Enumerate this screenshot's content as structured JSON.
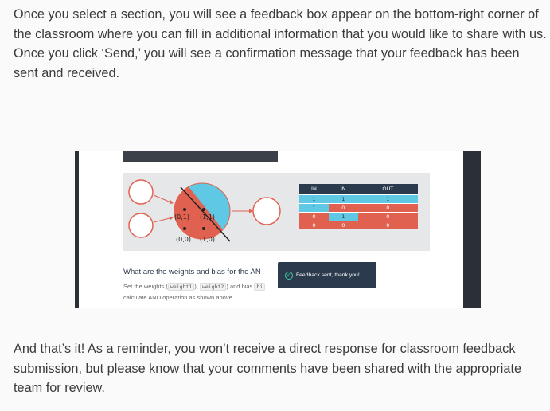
{
  "intro_paragraph": "Once you select a section, you will see a feedback box appear on the bottom-right corner of the classroom where you can fill in additional information that you would like to share with us. Once you click ‘Send,’ you will see a confirmation message that your feedback has been sent and received.",
  "outro_paragraph": "And that’s it! As a reminder, you won’t receive a direct response for classroom feedback submission, but please know that your comments have been shared with the appropriate team for review.",
  "screenshot": {
    "diagram": {
      "point_labels": [
        "(0,1)",
        "(1,1)",
        "(0,0)",
        "(1,0)"
      ]
    },
    "truth_table": {
      "headers": [
        "IN",
        "IN",
        "OUT"
      ],
      "rows": [
        [
          "1",
          "1",
          "1"
        ],
        [
          "1",
          "0",
          "0"
        ],
        [
          "0",
          "1",
          "0"
        ],
        [
          "0",
          "0",
          "0"
        ]
      ]
    },
    "question": {
      "title": "What are the weights and bias for the AN",
      "desc_prefix": "Set the weights (",
      "weight1": "weight1",
      "sep": "), ",
      "weight2": "weight2",
      "desc_mid": ") and bias ",
      "bias": "bi",
      "desc_line2": "calculate AND operation as shown above."
    },
    "toast": {
      "icon": "check-circle-icon",
      "message": "Feedback sent, thank you!"
    },
    "colors": {
      "blue": "#5ec8e5",
      "red": "#e06150",
      "navy": "#2b3a4d",
      "green": "#3fd0a0"
    }
  }
}
